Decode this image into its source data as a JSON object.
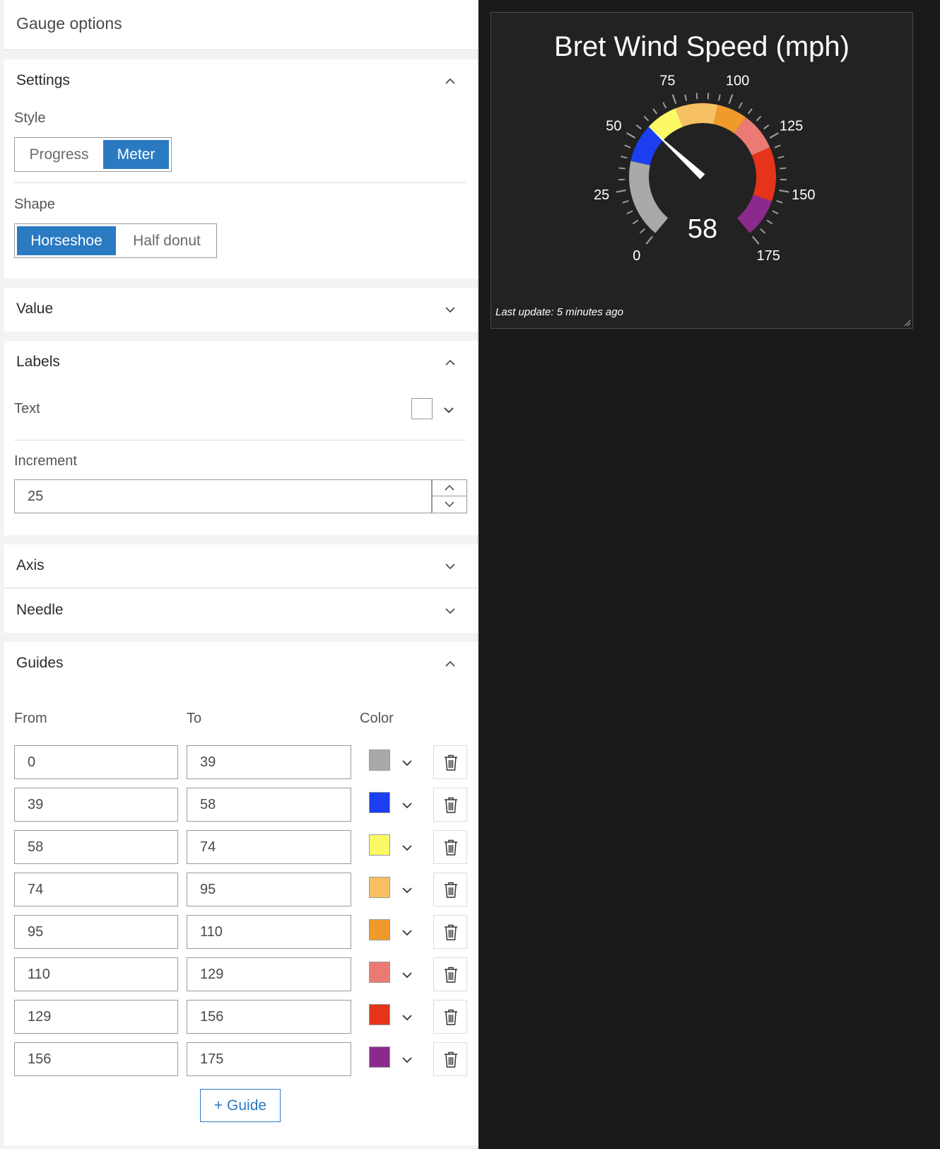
{
  "panel": {
    "title": "Gauge options",
    "settings": {
      "title": "Settings",
      "style_label": "Style",
      "style_options": [
        "Progress",
        "Meter"
      ],
      "style_selected": "Meter",
      "shape_label": "Shape",
      "shape_options": [
        "Horseshoe",
        "Half donut"
      ],
      "shape_selected": "Horseshoe"
    },
    "value": {
      "title": "Value"
    },
    "labels": {
      "title": "Labels",
      "text_label": "Text",
      "text_color": "#ffffff",
      "increment_label": "Increment",
      "increment_value": "25"
    },
    "axis": {
      "title": "Axis"
    },
    "needle": {
      "title": "Needle"
    },
    "guides": {
      "title": "Guides",
      "col_from": "From",
      "col_to": "To",
      "col_color": "Color",
      "rows": [
        {
          "from": "0",
          "to": "39",
          "color": "#a9a9a9"
        },
        {
          "from": "39",
          "to": "58",
          "color": "#1b3ff0"
        },
        {
          "from": "58",
          "to": "74",
          "color": "#fbfa66"
        },
        {
          "from": "74",
          "to": "95",
          "color": "#f7c062"
        },
        {
          "from": "95",
          "to": "110",
          "color": "#f09a2c"
        },
        {
          "from": "110",
          "to": "129",
          "color": "#ec7a74"
        },
        {
          "from": "129",
          "to": "156",
          "color": "#e5341a"
        },
        {
          "from": "156",
          "to": "175",
          "color": "#8a2a8c"
        }
      ],
      "add_label": "+ Guide"
    }
  },
  "gauge": {
    "title": "Bret Wind Speed (mph)",
    "value": 58,
    "value_text": "58",
    "min": 0,
    "max": 175,
    "ticks": [
      "0",
      "25",
      "50",
      "75",
      "100",
      "125",
      "150",
      "175"
    ],
    "footer": "Last update: 5 minutes ago",
    "needle_color": "#ffffff",
    "tick_color": "#9a9a9a"
  }
}
